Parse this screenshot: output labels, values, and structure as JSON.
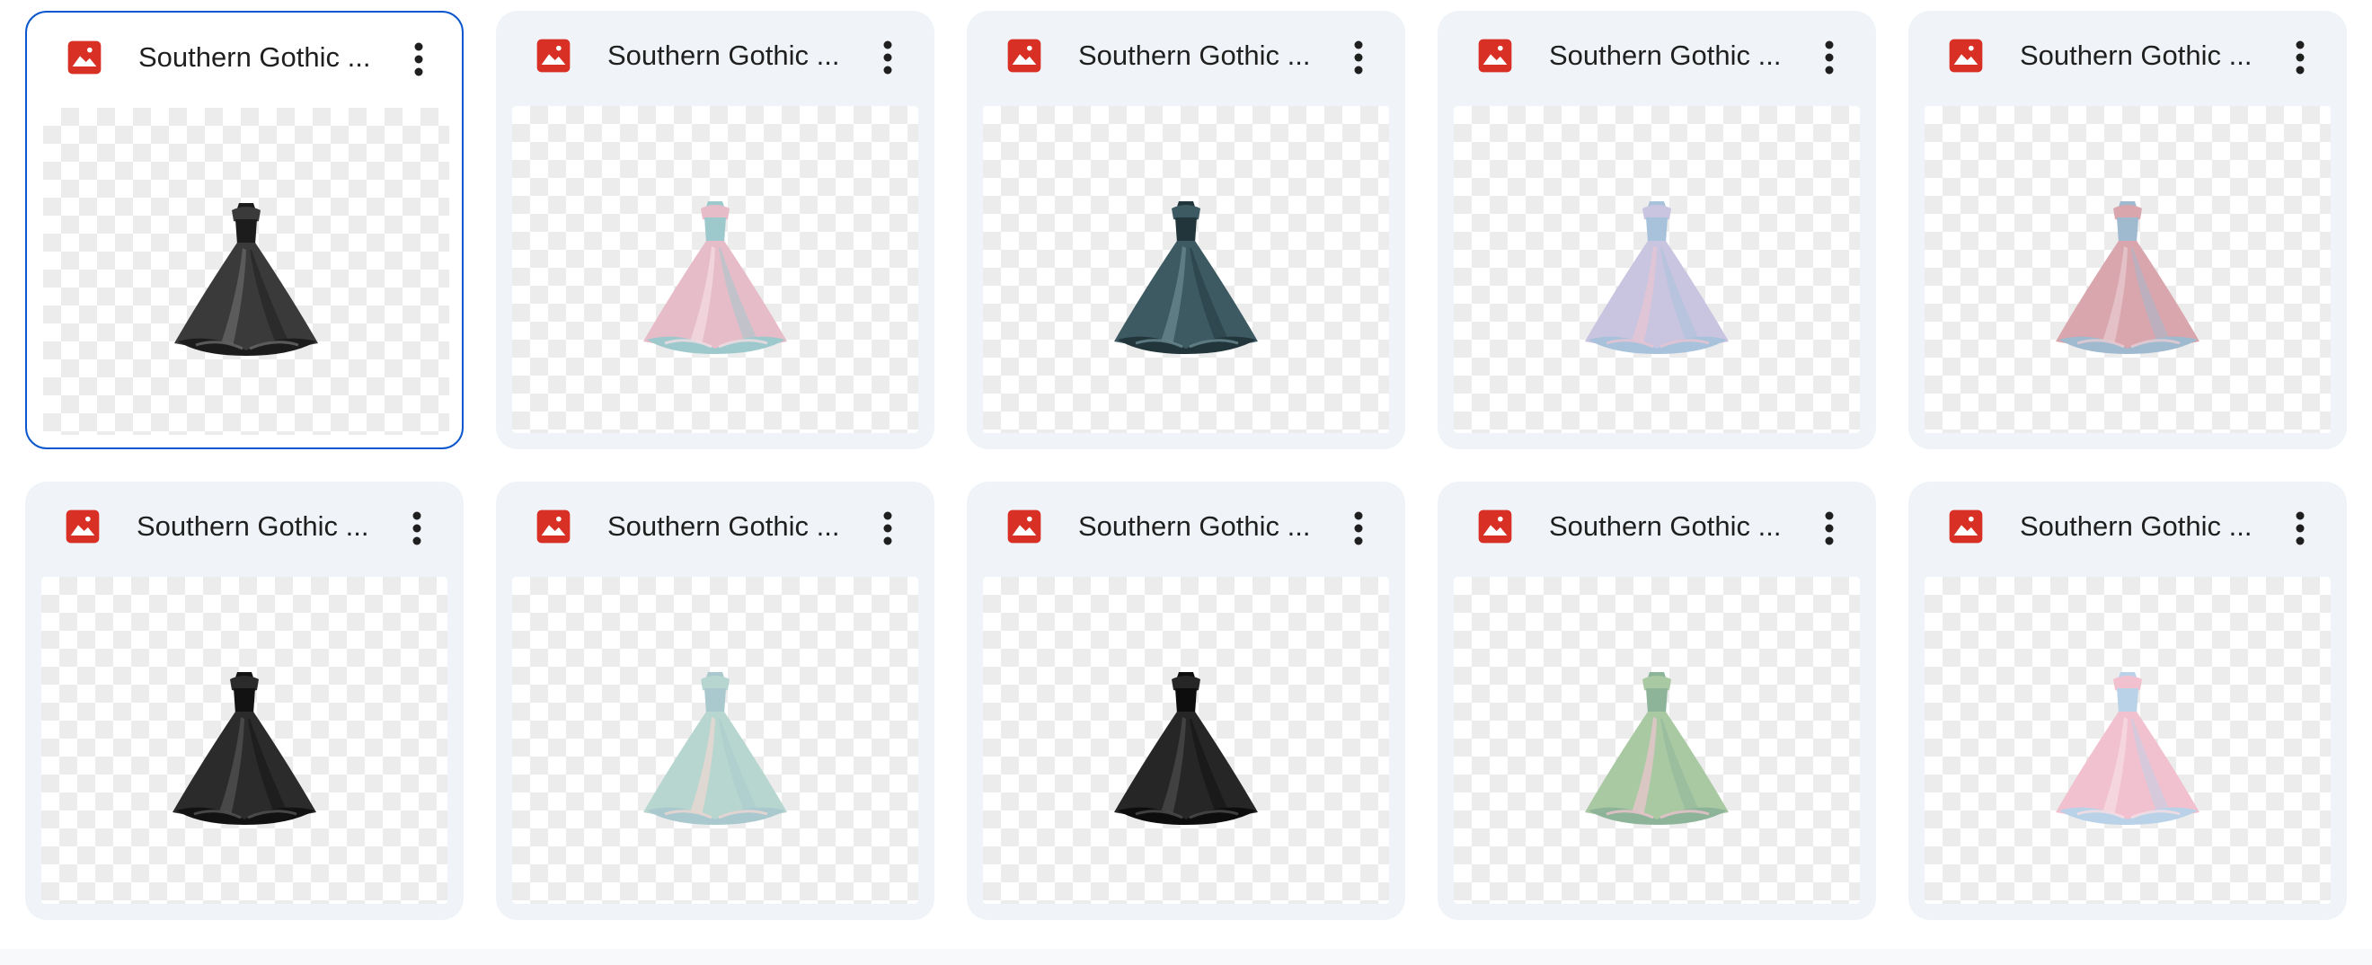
{
  "files": [
    {
      "title": "Southern Gothic ...",
      "icon": "image-file-icon",
      "thumbnail": "dark-charcoal-ruffled-gown",
      "colors": [
        "#3a3a3a",
        "#1c1c1c",
        "#6a6a6a"
      ],
      "selected": true
    },
    {
      "title": "Southern Gothic ...",
      "icon": "image-file-icon",
      "thumbnail": "pink-and-teal-gown",
      "colors": [
        "#e6bcc8",
        "#9ec9cc",
        "#f3dde3"
      ],
      "selected": false
    },
    {
      "title": "Southern Gothic ...",
      "icon": "image-file-icon",
      "thumbnail": "dark-teal-gown",
      "colors": [
        "#3d5a63",
        "#22353b",
        "#6c8a92"
      ],
      "selected": false
    },
    {
      "title": "Southern Gothic ...",
      "icon": "image-file-icon",
      "thumbnail": "lavender-blue-pink-gown",
      "colors": [
        "#c9c5e0",
        "#a8c2dc",
        "#e9c4d2"
      ],
      "selected": false
    },
    {
      "title": "Southern Gothic ...",
      "icon": "image-file-icon",
      "thumbnail": "rose-and-blue-gown",
      "colors": [
        "#d9a6ad",
        "#9fb9cf",
        "#e8cdd2"
      ],
      "selected": false
    },
    {
      "title": "Southern Gothic ...",
      "icon": "image-file-icon",
      "thumbnail": "black-tulle-gown",
      "colors": [
        "#2b2b2b",
        "#121212",
        "#555555"
      ],
      "selected": false
    },
    {
      "title": "Southern Gothic ...",
      "icon": "image-file-icon",
      "thumbnail": "mint-and-blush-gown",
      "colors": [
        "#b7d6cf",
        "#a9c9cf",
        "#efd7d2"
      ],
      "selected": false
    },
    {
      "title": "Southern Gothic ...",
      "icon": "image-file-icon",
      "thumbnail": "black-ballgown",
      "colors": [
        "#262626",
        "#0d0d0d",
        "#4d4d4d"
      ],
      "selected": false
    },
    {
      "title": "Southern Gothic ...",
      "icon": "image-file-icon",
      "thumbnail": "sage-green-and-pink-gown",
      "colors": [
        "#a9c9a3",
        "#8db399",
        "#efc4ce"
      ],
      "selected": false
    },
    {
      "title": "Southern Gothic ...",
      "icon": "image-file-icon",
      "thumbnail": "pastel-pink-blue-gown",
      "colors": [
        "#f2c1cf",
        "#b9d2e8",
        "#f7dde4"
      ],
      "selected": false
    }
  ],
  "more_actions_icon": "more-vert-icon",
  "accent_color": "#0b57d0",
  "file_icon_color": "#d93025"
}
